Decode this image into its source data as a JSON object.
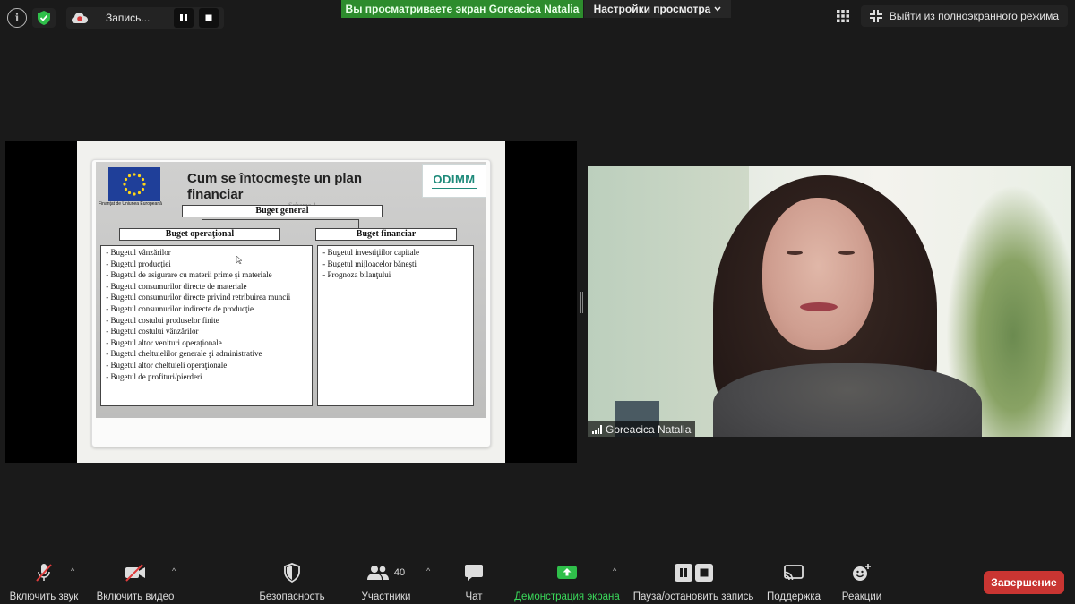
{
  "top_bar": {
    "recording_label": "Запись...",
    "share_banner": "Вы просматриваете экран Goreacica Natalia",
    "view_options": "Настройки просмотра",
    "exit_fullscreen": "Выйти из полноэкранного режима"
  },
  "slide": {
    "title": "Cum se întocmeşte un plan financiar",
    "eu_caption": "Finanţat de Uniunea Europeană",
    "logo_text": "ODIMM",
    "schema_label": "Schema 1",
    "general_budget": "Buget general",
    "operational_budget": "Buget operaţional",
    "financial_budget": "Buget financiar",
    "operational_items": [
      " - Bugetul vânzărilor",
      " - Bugetul producţiei",
      " - Bugetul de asigurare cu materii prime şi materiale",
      " - Bugetul consumurilor directe de materiale",
      " - Bugetul consumurilor directe privind retribuirea muncii",
      " - Bugetul consumurilor indirecte de producţie",
      " - Bugetul costului produselor finite",
      " - Bugetul costului vânzărilor",
      " - Bugetul altor venituri operaţionale",
      " - Bugetul cheltuielilor generale şi administrative",
      " - Bugetul altor cheltuieli operaţionale",
      " - Bugetul de profituri/pierderi"
    ],
    "financial_items": [
      " - Bugetul investiţiilor capitale",
      " - Bugetul mijloacelor băneşti",
      " - Prognoza bilanţului"
    ]
  },
  "participant": {
    "name": "Goreacica Natalia"
  },
  "toolbar": {
    "unmute": "Включить звук",
    "start_video": "Включить видео",
    "security": "Безопасность",
    "participants": "Участники",
    "participants_count": "40",
    "chat": "Чат",
    "share_screen": "Демонстрация экрана",
    "pause_recording": "Пауза/остановить запись",
    "support": "Поддержка",
    "reactions": "Реакции",
    "end": "Завершение"
  },
  "colors": {
    "share_banner": "#2d8c2d",
    "end_button": "#c93532",
    "share_icon": "#2fbf4a"
  }
}
